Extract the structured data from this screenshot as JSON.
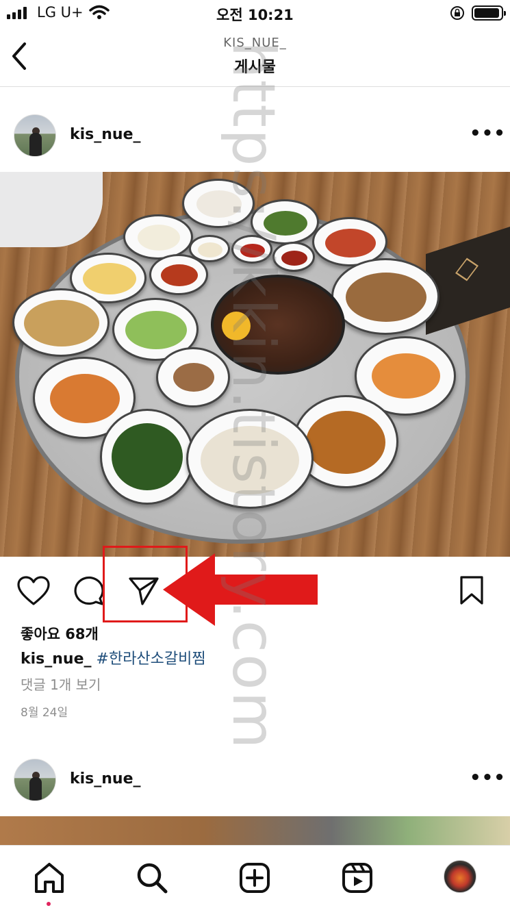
{
  "status_bar": {
    "carrier": "LG U+",
    "time": "오전 10:21"
  },
  "header": {
    "subtitle": "KIS_NUE_",
    "title": "게시물"
  },
  "post": {
    "username": "kis_nue_",
    "likes": "좋아요 68개",
    "caption_user": "kis_nue_",
    "caption_tag": "#한라산소갈비찜",
    "comments_link": "댓글 1개 보기",
    "date": "8월 24일"
  },
  "next_post": {
    "username": "kis_nue_"
  },
  "watermark": "https://kkin.tistory.com",
  "colors": {
    "annotation": "#e01a1a",
    "hashtag": "#1e4d7a",
    "notification_dot": "#e0245e"
  },
  "icons": [
    "back-icon",
    "more-icon",
    "heart-icon",
    "comment-icon",
    "share-icon",
    "bookmark-icon",
    "home-icon",
    "search-icon",
    "add-icon",
    "reels-icon",
    "profile-avatar"
  ]
}
